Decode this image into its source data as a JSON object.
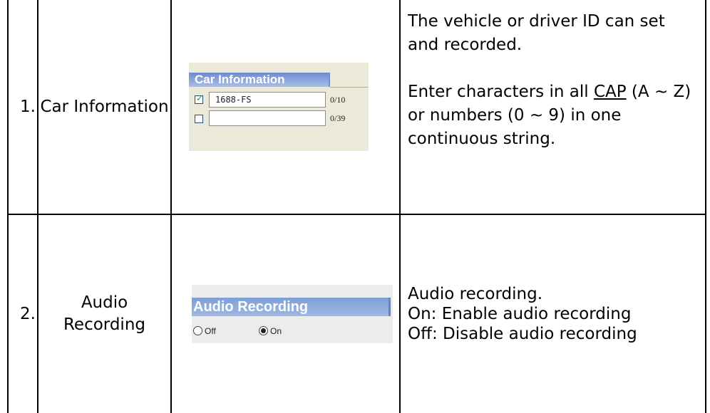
{
  "rows": [
    {
      "number": "1.",
      "name": "Car Information",
      "panel": {
        "title": "Car Information",
        "fields": [
          {
            "checked": true,
            "value": "1688-FS",
            "count": "0/10"
          },
          {
            "checked": false,
            "value": "",
            "count": "0/39"
          }
        ]
      },
      "description": {
        "para1": "The vehicle or driver ID can set and recorded.",
        "para2_before": "Enter characters in all ",
        "para2_underlined": "CAP",
        "para2_after": " (A ~ Z) or numbers (0 ~ 9) in one continuous string."
      }
    },
    {
      "number": "2.",
      "name": "Audio Recording",
      "panel": {
        "title": "Audio Recording",
        "options": [
          {
            "label": "Off",
            "selected": false
          },
          {
            "label": "On",
            "selected": true
          }
        ]
      },
      "description": {
        "line1": "Audio recording.",
        "line2": "On: Enable audio recording",
        "line3": "Off: Disable audio recording"
      }
    }
  ],
  "colors": {
    "panel_bg": "#ece9d8",
    "header_blue": "#6d8ccf",
    "check_green": "#21a121"
  }
}
